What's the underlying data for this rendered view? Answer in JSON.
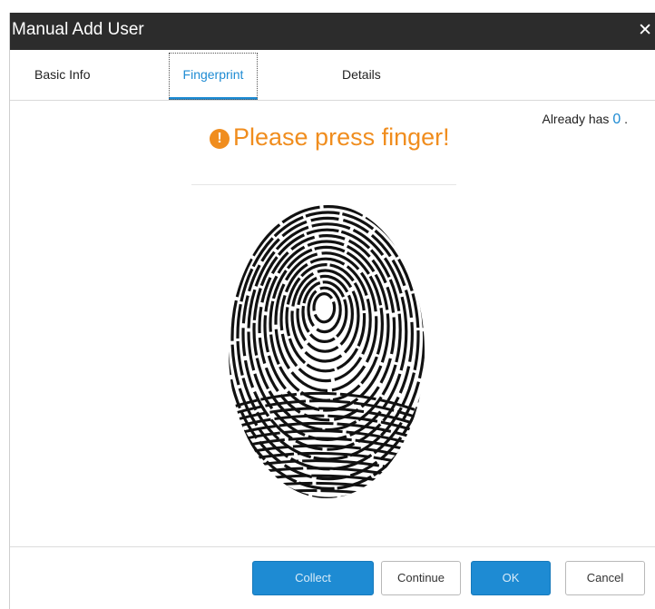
{
  "dialog": {
    "title": "Manual Add User",
    "close_icon": "close-icon"
  },
  "tabs": [
    {
      "label": "Basic Info"
    },
    {
      "label": "Fingerprint"
    },
    {
      "label": "Details"
    }
  ],
  "status": {
    "already_prefix": "Already has",
    "count": "0",
    "suffix": ".",
    "prompt": "Please press finger!",
    "prompt_icon": "info-icon"
  },
  "image": {
    "icon": "fingerprint-image"
  },
  "buttons": {
    "collect": "Collect",
    "continue": "Continue",
    "ok": "OK",
    "cancel": "Cancel"
  },
  "colors": {
    "titlebar": "#2c2c2c",
    "accent": "#1e8bd3",
    "warning": "#f08d1e"
  }
}
